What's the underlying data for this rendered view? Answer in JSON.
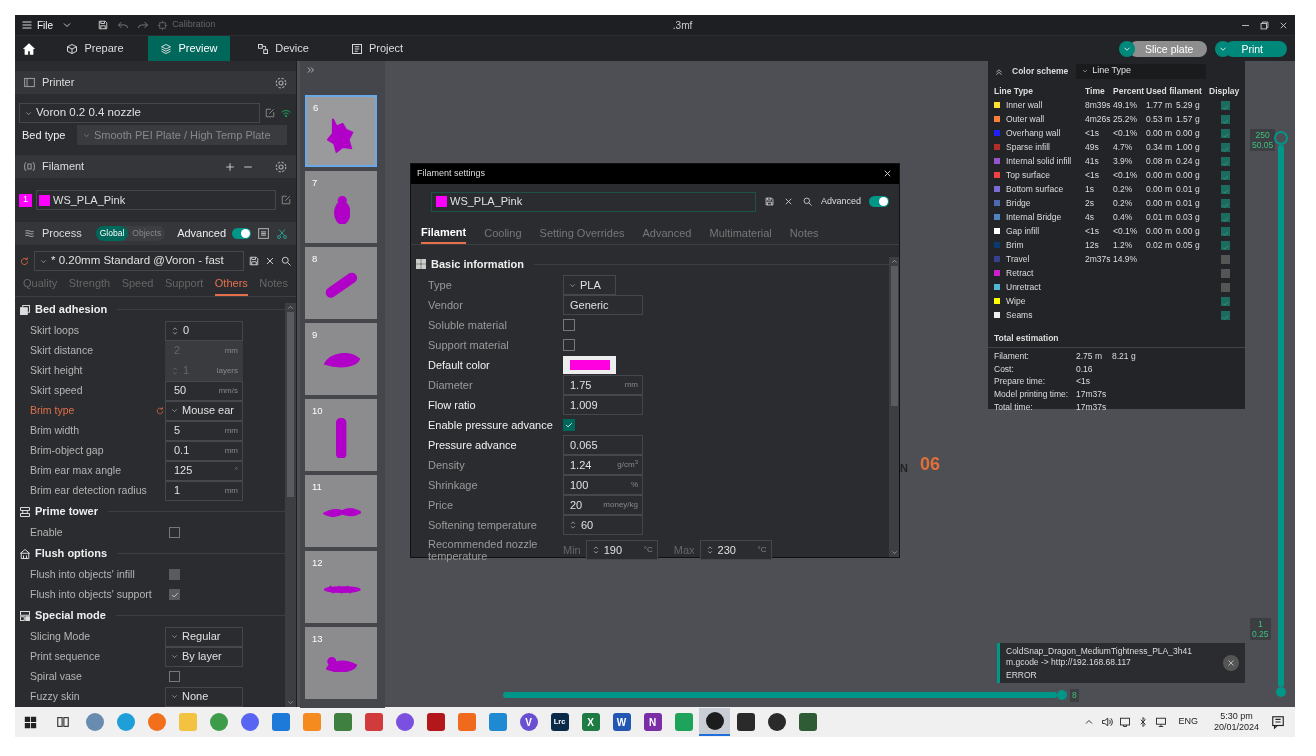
{
  "title_bar": {
    "menu": "File",
    "calibration": "Calibration",
    "file_name": ".3mf"
  },
  "tabs": [
    {
      "label": "Prepare",
      "selected": false
    },
    {
      "label": "Preview",
      "selected": true
    },
    {
      "label": "Device",
      "selected": false
    },
    {
      "label": "Project",
      "selected": false
    }
  ],
  "actions": [
    {
      "label": "Slice plate",
      "primary": false
    },
    {
      "label": "Print",
      "primary": true
    }
  ],
  "sidebar": {
    "printer": {
      "title": "Printer",
      "preset": "Voron 0.2 0.4 nozzle",
      "bed_type_label": "Bed type",
      "bed_type": "Smooth PEI Plate / High Temp Plate"
    },
    "filament": {
      "title": "Filament",
      "items": [
        {
          "index": "1",
          "name": "WS_PLA_Pink",
          "color": "#ff00ff"
        }
      ]
    },
    "process": {
      "title": "Process",
      "scopes": [
        {
          "label": "Global",
          "selected": true
        },
        {
          "label": "Objects",
          "selected": false
        }
      ],
      "advanced_label": "Advanced",
      "advanced": true,
      "preset": "* 0.20mm Standard @Voron - fast",
      "modified": true
    },
    "tabs": [
      {
        "label": "Quality",
        "selected": false
      },
      {
        "label": "Strength",
        "selected": false
      },
      {
        "label": "Speed",
        "selected": false
      },
      {
        "label": "Support",
        "selected": false
      },
      {
        "label": "Others",
        "selected": true
      },
      {
        "label": "Notes",
        "selected": false
      }
    ],
    "groups": [
      {
        "title": "Bed adhesion",
        "options": [
          {
            "label": "Skirt loops",
            "kind": "spin",
            "value": "0",
            "disabled": false,
            "modified": false
          },
          {
            "label": "Skirt distance",
            "kind": "number",
            "value": "2",
            "unit": "mm",
            "disabled": true,
            "modified": false
          },
          {
            "label": "Skirt height",
            "kind": "spin",
            "value": "1",
            "unit": "layers",
            "disabled": true,
            "modified": false
          },
          {
            "label": "Skirt speed",
            "kind": "number",
            "value": "50",
            "unit": "mm/s",
            "disabled": false,
            "modified": false
          },
          {
            "label": "Brim type",
            "kind": "select",
            "value": "Mouse ear",
            "disabled": false,
            "modified": true
          },
          {
            "label": "Brim width",
            "kind": "number",
            "value": "5",
            "unit": "mm",
            "disabled": false,
            "modified": false
          },
          {
            "label": "Brim-object gap",
            "kind": "number",
            "value": "0.1",
            "unit": "mm",
            "disabled": false,
            "modified": false
          },
          {
            "label": "Brim ear max angle",
            "kind": "number",
            "value": "125",
            "unit": "°",
            "disabled": false,
            "modified": false
          },
          {
            "label": "Brim ear detection radius",
            "kind": "number",
            "value": "1",
            "unit": "mm",
            "disabled": false,
            "modified": false
          }
        ]
      },
      {
        "title": "Prime tower",
        "options": [
          {
            "label": "Enable",
            "kind": "checkbox",
            "checked": false,
            "disabled": false,
            "modified": false
          }
        ]
      },
      {
        "title": "Flush options",
        "options": [
          {
            "label": "Flush into objects' infill",
            "kind": "checkbox",
            "checked": false,
            "disabled": true,
            "modified": false
          },
          {
            "label": "Flush into objects' support",
            "kind": "checkbox",
            "checked": true,
            "disabled": true,
            "modified": false
          }
        ]
      },
      {
        "title": "Special mode",
        "options": [
          {
            "label": "Slicing Mode",
            "kind": "select",
            "value": "Regular",
            "disabled": false,
            "modified": false
          },
          {
            "label": "Print sequence",
            "kind": "select",
            "value": "By layer",
            "disabled": false,
            "modified": false
          },
          {
            "label": "Spiral vase",
            "kind": "checkbox",
            "checked": false,
            "disabled": false,
            "modified": false
          },
          {
            "label": "Fuzzy skin",
            "kind": "select",
            "value": "None",
            "disabled": false,
            "modified": false
          }
        ]
      }
    ]
  },
  "plates": [
    {
      "label": "6",
      "selected": true
    },
    {
      "label": "7",
      "selected": false
    },
    {
      "label": "8",
      "selected": false
    },
    {
      "label": "9",
      "selected": false
    },
    {
      "label": "10",
      "selected": false
    },
    {
      "label": "11",
      "selected": false
    },
    {
      "label": "12",
      "selected": false
    },
    {
      "label": "13",
      "selected": false
    }
  ],
  "dialog": {
    "title": "Filament settings",
    "preset": "WS_PLA_Pink",
    "advanced_label": "Advanced",
    "advanced": true,
    "tabs": [
      {
        "label": "Filament",
        "selected": true
      },
      {
        "label": "Cooling",
        "selected": false
      },
      {
        "label": "Setting Overrides",
        "selected": false
      },
      {
        "label": "Advanced",
        "selected": false
      },
      {
        "label": "Multimaterial",
        "selected": false
      },
      {
        "label": "Notes",
        "selected": false
      }
    ],
    "section": "Basic information",
    "options": [
      {
        "label": "Type",
        "kind": "select",
        "value": "PLA",
        "customized": false
      },
      {
        "label": "Vendor",
        "kind": "text",
        "value": "Generic",
        "customized": false
      },
      {
        "label": "Soluble material",
        "kind": "checkbox",
        "checked": false,
        "customized": false
      },
      {
        "label": "Support material",
        "kind": "checkbox",
        "checked": false,
        "customized": false
      },
      {
        "label": "Default color",
        "kind": "color",
        "color": "#ff00e0",
        "customized": true
      },
      {
        "label": "Diameter",
        "kind": "number",
        "value": "1.75",
        "unit": "mm",
        "customized": false
      },
      {
        "label": "Flow ratio",
        "kind": "number",
        "value": "1.009",
        "customized": true
      },
      {
        "label": "Enable pressure advance",
        "kind": "checkbox",
        "checked": true,
        "customized": true
      },
      {
        "label": "Pressure advance",
        "kind": "number",
        "value": "0.065",
        "customized": true
      },
      {
        "label": "Density",
        "kind": "number",
        "value": "1.24",
        "unit": "g/cm$^{3}$",
        "customized": false
      },
      {
        "label": "Shrinkage",
        "kind": "number",
        "value": "100",
        "unit": "%",
        "customized": false
      },
      {
        "label": "Price",
        "kind": "number",
        "value": "20",
        "unit": "money/kg",
        "customized": false
      },
      {
        "label": "Softening temperature",
        "kind": "spin",
        "value": "60",
        "customized": false
      },
      {
        "label": "Recommended nozzle temperature",
        "kind": "range",
        "min_label": "Min",
        "min": "190",
        "max_label": "Max",
        "max": "230",
        "min_unit": "°C",
        "max_unit": "°C",
        "customized": false
      }
    ]
  },
  "legend": {
    "title": "Color scheme",
    "scheme": "Line Type",
    "columns": [
      "Line Type",
      "Time",
      "Percent",
      "Used filament",
      "Display"
    ],
    "rows": [
      {
        "name": "Inner wall",
        "color": "#ffe033",
        "time": "8m39s",
        "percent": "49.1%",
        "length": "1.77 m",
        "weight": "5.29 g",
        "display": true
      },
      {
        "name": "Outer wall",
        "color": "#ff7f39",
        "time": "4m26s",
        "percent": "25.2%",
        "length": "0.53 m",
        "weight": "1.57 g",
        "display": true
      },
      {
        "name": "Overhang wall",
        "color": "#1f1fff",
        "time": "<1s",
        "percent": "<0.1%",
        "length": "0.00 m",
        "weight": "0.00 g",
        "display": true
      },
      {
        "name": "Sparse infill",
        "color": "#b03029",
        "time": "49s",
        "percent": "4.7%",
        "length": "0.34 m",
        "weight": "1.00 g",
        "display": true
      },
      {
        "name": "Internal solid infill",
        "color": "#9654cc",
        "time": "41s",
        "percent": "3.9%",
        "length": "0.08 m",
        "weight": "0.24 g",
        "display": true
      },
      {
        "name": "Top surface",
        "color": "#f04040",
        "time": "<1s",
        "percent": "<0.1%",
        "length": "0.00 m",
        "weight": "0.00 g",
        "display": true
      },
      {
        "name": "Bottom surface",
        "color": "#7a6bd6",
        "time": "1s",
        "percent": "0.2%",
        "length": "0.00 m",
        "weight": "0.01 g",
        "display": true
      },
      {
        "name": "Bridge",
        "color": "#4d6ab0",
        "time": "2s",
        "percent": "0.2%",
        "length": "0.00 m",
        "weight": "0.01 g",
        "display": true
      },
      {
        "name": "Internal Bridge",
        "color": "#4f84c4",
        "time": "4s",
        "percent": "0.4%",
        "length": "0.01 m",
        "weight": "0.03 g",
        "display": true
      },
      {
        "name": "Gap infill",
        "color": "#ffffff",
        "time": "<1s",
        "percent": "<0.1%",
        "length": "0.00 m",
        "weight": "0.00 g",
        "display": true
      },
      {
        "name": "Brim",
        "color": "#0a3a6e",
        "time": "12s",
        "percent": "1.2%",
        "length": "0.02 m",
        "weight": "0.05 g",
        "display": true
      },
      {
        "name": "Travel",
        "color": "#38408f",
        "time": "2m37s",
        "percent": "14.9%",
        "display": false
      },
      {
        "name": "Retract",
        "color": "#cd1fcd",
        "display": false
      },
      {
        "name": "Unretract",
        "color": "#4fb8d8",
        "display": false
      },
      {
        "name": "Wipe",
        "color": "#ffff00",
        "display": true
      },
      {
        "name": "Seams",
        "color": "#f0f0f0",
        "display": true
      }
    ],
    "total_title": "Total estimation",
    "totals": [
      {
        "label": "Filament:",
        "values": [
          "2.75 m",
          "8.21 g"
        ]
      },
      {
        "label": "Cost:",
        "values": [
          "0.16"
        ]
      },
      {
        "label": "Prepare time:",
        "values": [
          "<1s"
        ]
      },
      {
        "label": "Model printing time:",
        "values": [
          "17m37s"
        ]
      },
      {
        "label": "Total time:",
        "values": [
          "17m37s"
        ]
      }
    ]
  },
  "layer_slider": {
    "top_labels": [
      "250",
      "50.05"
    ],
    "bottom_labels": [
      "1",
      "0.25"
    ],
    "level": 1
  },
  "move_slider": {
    "label": "8",
    "level": 1
  },
  "marker": {
    "letter": "N",
    "label": "06"
  },
  "notification": {
    "lines": [
      "ColdSnap_Dragon_MediumTightness_PLA_3h41",
      "m.gcode -> http://192.168.68.117"
    ],
    "status": "ERROR"
  },
  "taskbar": {
    "apps": [
      {
        "kind": "cloud",
        "active": false
      },
      {
        "kind": "edge",
        "active": false
      },
      {
        "kind": "firefox",
        "active": false
      },
      {
        "kind": "folder",
        "active": false
      },
      {
        "kind": "chrome",
        "active": false
      },
      {
        "kind": "discord",
        "active": false
      },
      {
        "kind": "bluegear",
        "active": false
      },
      {
        "kind": "sublime",
        "active": false
      },
      {
        "kind": "photo",
        "active": false
      },
      {
        "kind": "popcorn",
        "active": false
      },
      {
        "kind": "play",
        "active": false
      },
      {
        "kind": "redtile",
        "active": false
      },
      {
        "kind": "orangetile",
        "active": false
      },
      {
        "kind": "vscode",
        "active": false
      },
      {
        "kind": "letter",
        "label": "V",
        "active": false
      },
      {
        "kind": "lrc",
        "label": "Lrc",
        "active": false
      },
      {
        "kind": "excel",
        "label": "X",
        "active": false
      },
      {
        "kind": "word",
        "label": "W",
        "active": false
      },
      {
        "kind": "onenote",
        "label": "N",
        "active": false
      },
      {
        "kind": "sheet",
        "active": false
      },
      {
        "kind": "orca",
        "active": true
      },
      {
        "kind": "fan",
        "active": false
      },
      {
        "kind": "gauge",
        "active": false
      },
      {
        "kind": "terminal",
        "active": false
      }
    ],
    "language": "ENG",
    "time": "5:30 pm",
    "date": "20/01/2024"
  }
}
